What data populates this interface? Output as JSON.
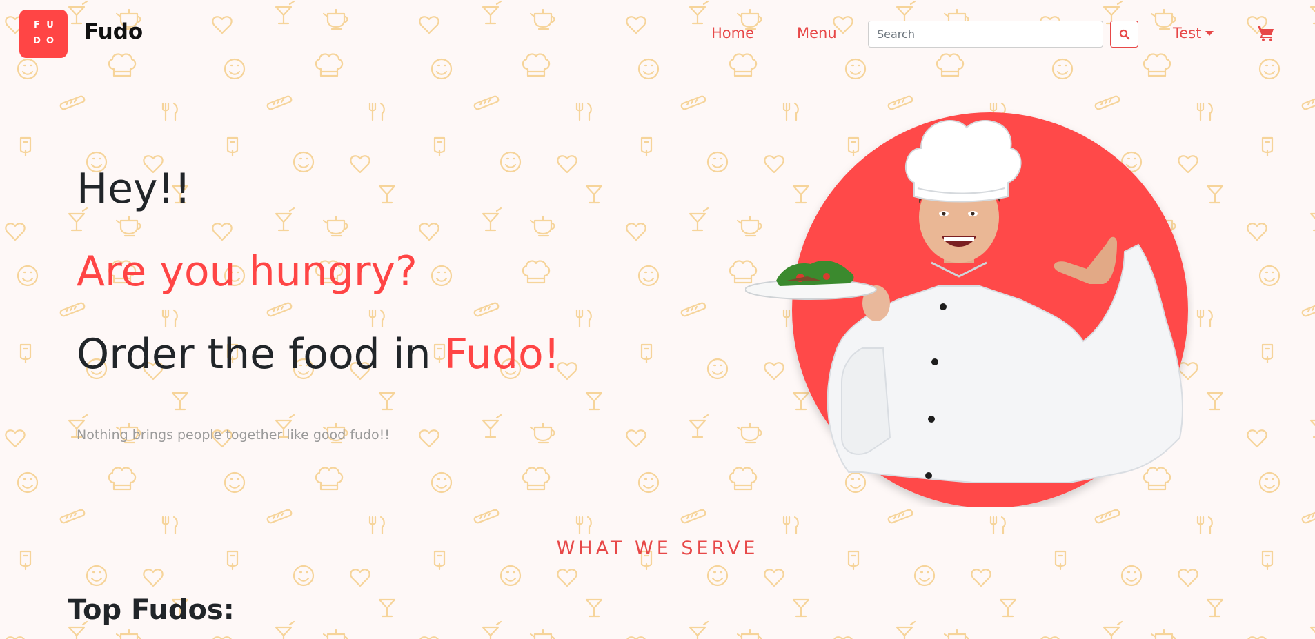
{
  "header": {
    "logo_letters": [
      "F",
      "U",
      "D",
      "O"
    ],
    "brand": "Fudo",
    "nav": {
      "home": "Home",
      "menu": "Menu"
    },
    "search": {
      "placeholder": "Search",
      "value": ""
    },
    "search_icon": "search-icon",
    "user_menu_label": "Test",
    "cart_icon": "cart-icon"
  },
  "hero": {
    "greeting": "Hey!!",
    "question": "Are you hungry?",
    "order_prefix": "Order the food in ",
    "order_brand": "Fudo!",
    "tagline": "Nothing brings people together like good fudo!!",
    "image": "chef-holding-plate"
  },
  "section": {
    "kicker": "WHAT WE SERVE",
    "heading": "Top Fudos:"
  },
  "colors": {
    "accent": "#ff4545",
    "link": "#e74848",
    "background": "#fef8f7",
    "pattern": "#f6d49a"
  }
}
